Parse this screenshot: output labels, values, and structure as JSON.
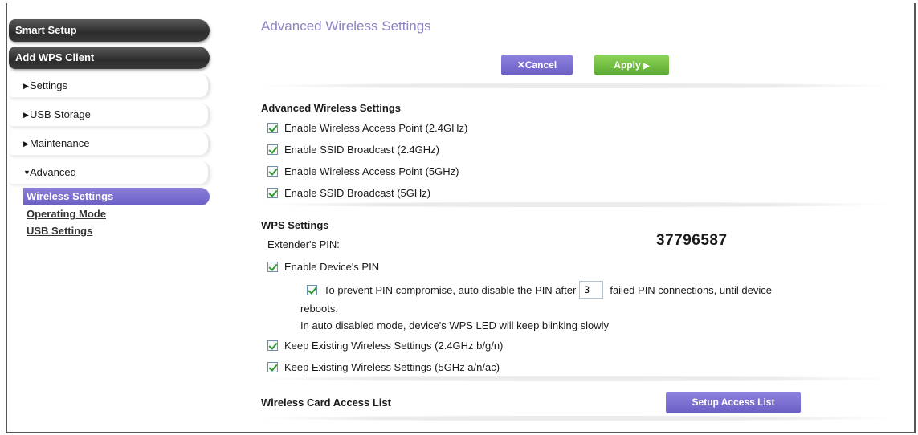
{
  "sidebar": {
    "smart_setup": "Smart Setup",
    "add_wps_client": "Add WPS Client",
    "items": [
      {
        "arrow": "▶",
        "label": "Settings"
      },
      {
        "arrow": "▶",
        "label": "USB Storage"
      },
      {
        "arrow": "▶",
        "label": "Maintenance"
      },
      {
        "arrow": "▼",
        "label": "Advanced"
      }
    ],
    "sub_items": {
      "active": "Wireless Settings",
      "operating_mode": "Operating Mode",
      "usb_settings": "USB Settings"
    }
  },
  "main": {
    "title": "Advanced Wireless Settings",
    "cancel_label": "Cancel",
    "cancel_icon": "✕",
    "apply_label": "Apply",
    "apply_icon": "▶",
    "advanced_section": {
      "heading": "Advanced Wireless Settings",
      "options": [
        {
          "label": "Enable Wireless Access Point (2.4GHz)",
          "checked": true
        },
        {
          "label": "Enable SSID Broadcast (2.4GHz)",
          "checked": true
        },
        {
          "label": "Enable Wireless Access Point (5GHz)",
          "checked": true
        },
        {
          "label": "Enable SSID Broadcast (5GHz)",
          "checked": true
        }
      ]
    },
    "wps_section": {
      "heading": "WPS Settings",
      "pin_label": "Extender's PIN:",
      "pin_value": "37796587",
      "enable_pin_label": "Enable Device's PIN",
      "auto_disable_pre": "To prevent PIN compromise, auto disable the PIN after",
      "auto_disable_value": "3",
      "auto_disable_post": "failed PIN connections, until device",
      "auto_disable_wrap": "reboots.",
      "auto_disable_note": "In auto disabled mode, device's WPS LED will keep blinking slowly",
      "keep_24": "Keep Existing Wireless Settings (2.4GHz b/g/n)",
      "keep_5": "Keep Existing Wireless Settings (5GHz a/n/ac)"
    },
    "access_list": {
      "label": "Wireless Card Access List",
      "button": "Setup Access List"
    }
  }
}
